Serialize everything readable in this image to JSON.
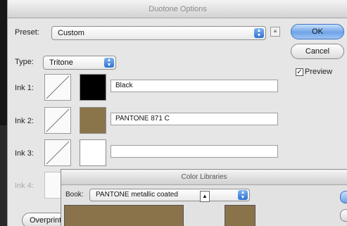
{
  "dialog": {
    "title": "Duotone Options",
    "preset_label": "Preset:",
    "preset_value": "Custom",
    "type_label": "Type:",
    "type_value": "Tritone",
    "ok_label": "OK",
    "cancel_label": "Cancel",
    "preview_label": "Preview",
    "preview_checked": true,
    "overprint_label": "Overprint Colors...",
    "inks": [
      {
        "label": "Ink 1:",
        "name": "Black",
        "color": "#000000"
      },
      {
        "label": "Ink 2:",
        "name": "PANTONE 871 C",
        "color": "#8a7449"
      },
      {
        "label": "Ink 3:",
        "name": "",
        "color": "#ffffff"
      },
      {
        "label": "Ink 4:",
        "name": "",
        "color": "#ffffff"
      }
    ]
  },
  "color_libraries": {
    "title": "Color Libraries",
    "book_label": "Book:",
    "book_value": "PANTONE metallic coated",
    "swatch_color": "#8a734a"
  },
  "colors": {
    "accent": "#3d72c4"
  }
}
